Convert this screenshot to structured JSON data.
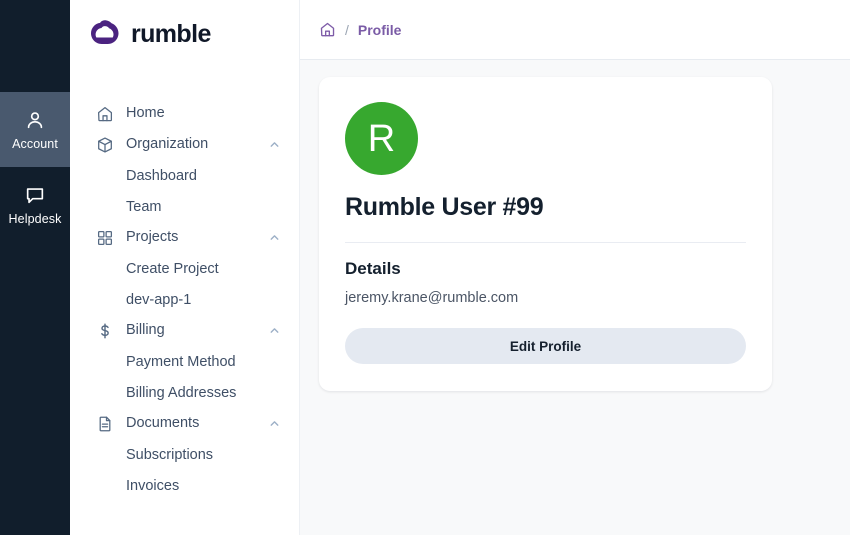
{
  "rail": {
    "items": [
      {
        "label": "Account",
        "icon": "user-icon",
        "active": true
      },
      {
        "label": "Helpdesk",
        "icon": "chat-bubble-icon",
        "active": false
      }
    ]
  },
  "sidebar": {
    "brand": {
      "word": "rumble",
      "mark_color": "#4b2380",
      "logo_icon": "rumble-cloud-logo"
    },
    "items": [
      {
        "label": "Home",
        "icon": "home-icon",
        "type": "link"
      },
      {
        "label": "Organization",
        "icon": "cube-icon",
        "type": "group",
        "chevron": "chevron-up-icon"
      },
      {
        "label": "Dashboard",
        "type": "sub"
      },
      {
        "label": "Team",
        "type": "sub"
      },
      {
        "label": "Projects",
        "icon": "grid-icon",
        "type": "group",
        "chevron": "chevron-up-icon"
      },
      {
        "label": "Create Project",
        "type": "sub"
      },
      {
        "label": "dev-app-1",
        "type": "sub"
      },
      {
        "label": "Billing",
        "icon": "dollar-icon",
        "type": "group",
        "chevron": "chevron-up-icon"
      },
      {
        "label": "Payment Method",
        "type": "sub"
      },
      {
        "label": "Billing Addresses",
        "type": "sub"
      },
      {
        "label": "Documents",
        "icon": "document-icon",
        "type": "group",
        "chevron": "chevron-up-icon"
      },
      {
        "label": "Subscriptions",
        "type": "sub"
      },
      {
        "label": "Invoices",
        "type": "sub"
      }
    ]
  },
  "topbar": {
    "breadcrumb": {
      "home_icon": "home-icon",
      "separator": "/",
      "current": "Profile"
    }
  },
  "profile_card": {
    "avatar_initial": "R",
    "avatar_color": "#37a82f",
    "name": "Rumble User #99",
    "details_heading": "Details",
    "email": "jeremy.krane@rumble.com",
    "edit_button_label": "Edit Profile"
  },
  "colors": {
    "rail_bg": "#111e2c",
    "rail_active": "#49596e",
    "accent_purple": "#7a5ba6",
    "brand_purple": "#4b2380",
    "avatar_green": "#37a82f",
    "button_bg": "#e4e9f1",
    "page_bg": "#f8f9fa"
  }
}
